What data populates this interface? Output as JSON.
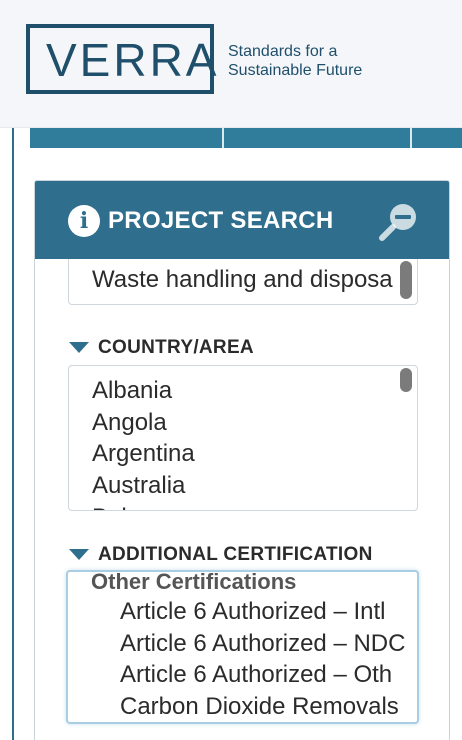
{
  "header": {
    "logo_text": "VERRA",
    "tagline_line1": "Standards for a",
    "tagline_line2": "Sustainable Future"
  },
  "panel": {
    "title": "PROJECT SEARCH",
    "info_icon": "info-icon",
    "zoom_icon": "zoom-out-icon"
  },
  "project_type": {
    "partial_item": "Waste handling and disposa"
  },
  "country": {
    "label": "COUNTRY/AREA",
    "options": [
      "Albania",
      "Angola",
      "Argentina",
      "Australia",
      "Bahamas"
    ]
  },
  "certification": {
    "label": "ADDITIONAL CERTIFICATION",
    "group": "Other Certifications",
    "options": [
      "Article 6 Authorized – Intl",
      "Article 6 Authorized – NDC",
      "Article 6 Authorized – Oth",
      "Carbon Dioxide Removals"
    ]
  },
  "colors": {
    "brand": "#1f4f6b",
    "panel_header": "#2f6f8d",
    "tab_bar": "#2f7d9b"
  }
}
